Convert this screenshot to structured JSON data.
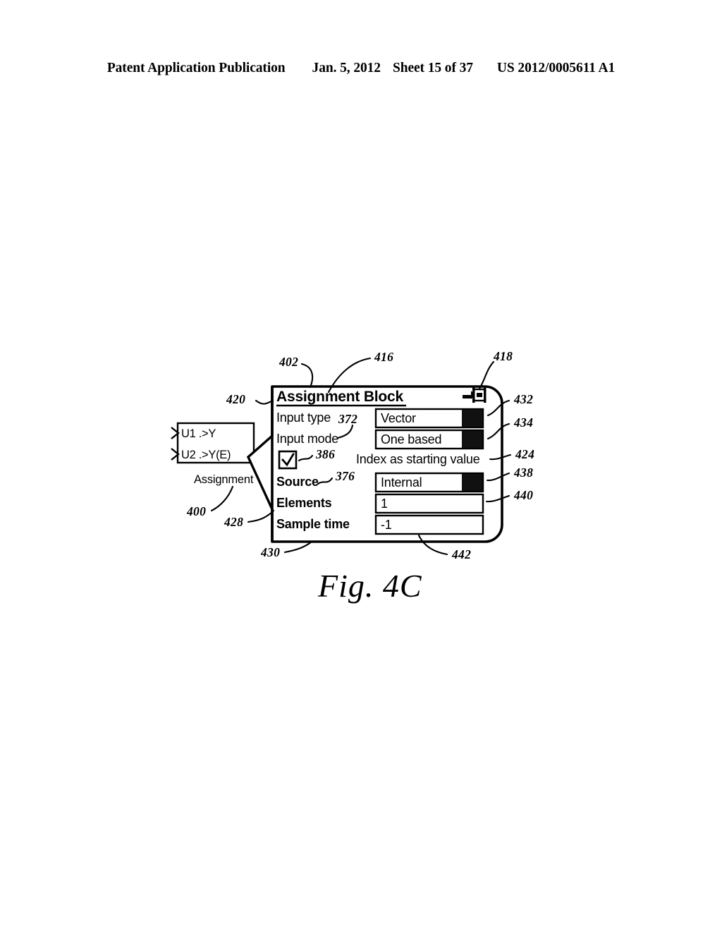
{
  "page": {
    "header": {
      "publication": "Patent Application Publication",
      "date": "Jan. 5, 2012",
      "sheet": "Sheet 15 of 37",
      "docnum": "US 2012/0005611 A1"
    },
    "figure_caption": "Fig. 4C"
  },
  "block": {
    "ports": [
      {
        "label": "U1 .>Y"
      },
      {
        "label": "U2 .>Y(E)"
      }
    ],
    "caption": "Assignment",
    "ref": "400"
  },
  "dialog": {
    "title": "Assignment Block",
    "pin_icon": "pushpin-icon",
    "rows": [
      {
        "label": "Input type",
        "value": "Vector",
        "control": "dropdown"
      },
      {
        "label": "Input mode",
        "value": "One based",
        "control": "dropdown"
      },
      {
        "label": "",
        "value": "Index as starting value",
        "control": "checkbox",
        "checked": true
      },
      {
        "label": "Source",
        "value": "Internal",
        "control": "dropdown"
      },
      {
        "label": "Elements",
        "value": "1",
        "control": "textfield"
      },
      {
        "label": "Sample time",
        "value": "-1",
        "control": "textfield"
      }
    ]
  },
  "reference_numerals": {
    "dialog_border": "402",
    "title_bar": "416",
    "pin": "418",
    "left_edge": "420",
    "index_label": "424",
    "labels_column": "428",
    "bottom_border": "430",
    "input_type_field": "432",
    "input_mode_field": "434",
    "source_field": "438",
    "elements_field": "440",
    "sample_time_field": "442",
    "input_mode_label": "372",
    "source_label": "376",
    "checkbox": "386"
  },
  "colors": {
    "ink": "#000000",
    "paper": "#ffffff",
    "dropdown_button": "#111111"
  }
}
